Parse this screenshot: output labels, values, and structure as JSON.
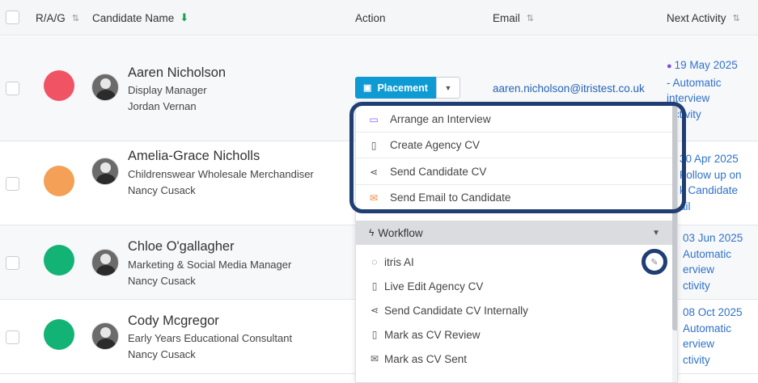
{
  "header": {
    "rag": "R/A/G",
    "candidate_name": "Candidate Name",
    "action": "Action",
    "email": "Email",
    "next_activity": "Next Activity"
  },
  "rows": [
    {
      "name": "Aaren Nicholson",
      "role": "Display Manager",
      "owner": "Jordan Vernan",
      "email": "aaren.nicholson@itristest.co.uk",
      "rag_color": "#f05464",
      "next": {
        "date": "19 May 2025",
        "l2": "- Automatic",
        "l3": "interview",
        "l4": "Activity"
      }
    },
    {
      "name": "Amelia-Grace Nicholls",
      "role": "Childrenswear Wholesale Merchandiser",
      "owner": "Nancy Cusack",
      "email": "",
      "rag_color": "#f4a056",
      "next": {
        "date": "30 Apr 2025",
        "l2": "Follow up on",
        "l3": "k Candidate",
        "l4": "ail"
      }
    },
    {
      "name": "Chloe O'gallagher",
      "role": "Marketing & Social Media Manager",
      "owner": "Nancy Cusack",
      "email": "",
      "rag_color": "#13b375",
      "next": {
        "date": "03 Jun 2025",
        "l2": "Automatic",
        "l3": "erview",
        "l4": "ctivity"
      }
    },
    {
      "name": "Cody Mcgregor",
      "role": "Early Years Educational Consultant",
      "owner": "Nancy Cusack",
      "email": "",
      "rag_color": "#13b375",
      "next": {
        "date": "08 Oct 2025",
        "l2": "Automatic",
        "l3": "erview",
        "l4": "ctivity"
      }
    }
  ],
  "placement_button": {
    "label": "Placement"
  },
  "dropdown": {
    "top_items": [
      {
        "label": "Arrange an Interview",
        "icon": "calendar-icon"
      },
      {
        "label": "Create Agency CV",
        "icon": "document-icon"
      },
      {
        "label": "Send Candidate CV",
        "icon": "share-icon"
      },
      {
        "label": "Send Email to Candidate",
        "icon": "envelope-icon"
      }
    ],
    "workflow_label": "Workflow",
    "workflow_items": [
      {
        "label": "itris AI",
        "icon": "chat-icon"
      },
      {
        "label": "Live Edit Agency CV",
        "icon": "document-icon"
      },
      {
        "label": "Send Candidate CV Internally",
        "icon": "share-icon"
      },
      {
        "label": "Mark as CV Review",
        "icon": "document-icon"
      },
      {
        "label": "Mark as CV Sent",
        "icon": "envelope-check-icon"
      }
    ]
  },
  "colors": {
    "accent": "#0e9ad3",
    "link": "#2563b8",
    "activity_link": "#2f72c9",
    "chat_icon": "#7c4ddb",
    "highlight": "#1f3e73",
    "sort_active": "#16a34a"
  }
}
